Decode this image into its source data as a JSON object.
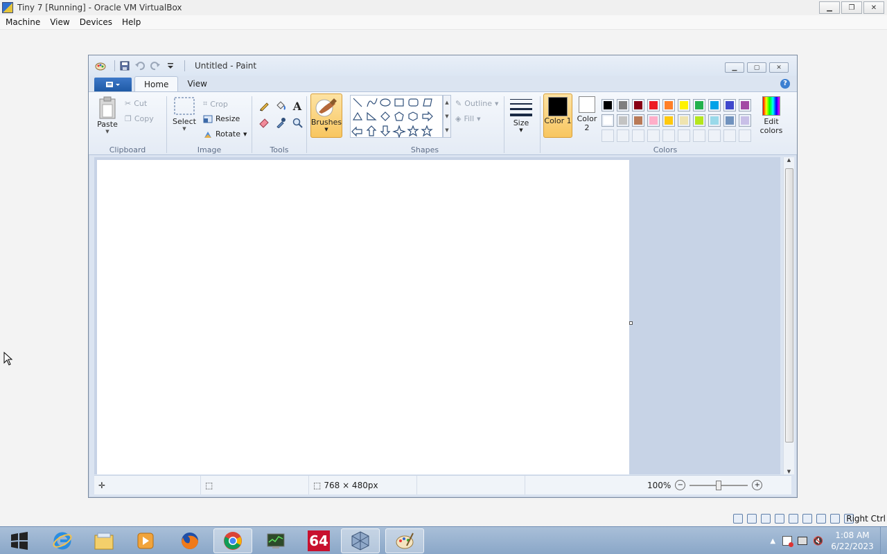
{
  "vbox": {
    "title": "Tiny 7 [Running] - Oracle VM VirtualBox",
    "menu": [
      "Machine",
      "View",
      "Devices",
      "Help"
    ],
    "status": {
      "host_key": "Right Ctrl"
    }
  },
  "paint": {
    "title": "Untitled - Paint",
    "tabs": [
      "Home",
      "View"
    ],
    "groups": {
      "clipboard": {
        "label": "Clipboard",
        "paste": "Paste",
        "cut": "Cut",
        "copy": "Copy"
      },
      "image": {
        "label": "Image",
        "select": "Select",
        "crop": "Crop",
        "resize": "Resize",
        "rotate": "Rotate"
      },
      "tools": {
        "label": "Tools"
      },
      "brushes": {
        "label": "Brushes"
      },
      "shapes": {
        "label": "Shapes",
        "outline": "Outline",
        "fill": "Fill"
      },
      "size": {
        "label": "Size"
      },
      "colors": {
        "label": "Colors",
        "color1": "Color 1",
        "color2": "Color 2",
        "edit": "Edit colors",
        "color1_value": "#000000",
        "color2_value": "#ffffff",
        "palette_row1": [
          "#000000",
          "#7f7f7f",
          "#880015",
          "#ed1c24",
          "#ff7f27",
          "#fff200",
          "#22b14c",
          "#00a2e8",
          "#3f48cc",
          "#a349a4"
        ],
        "palette_row2": [
          "#ffffff",
          "#c3c3c3",
          "#b97a57",
          "#ffaec9",
          "#ffc90e",
          "#efe4b0",
          "#b5e61d",
          "#99d9ea",
          "#7092be",
          "#c8bfe7"
        ]
      }
    },
    "status": {
      "image_size": "768 × 480px",
      "zoom": "100%"
    }
  },
  "taskbar": {
    "time": "1:08 AM",
    "date": "6/22/2023",
    "apps": [
      "internet-explorer",
      "file-explorer",
      "media-player",
      "firefox",
      "chrome",
      "task-manager",
      "aida64",
      "virtualbox",
      "paint"
    ],
    "aida_label": "64"
  }
}
